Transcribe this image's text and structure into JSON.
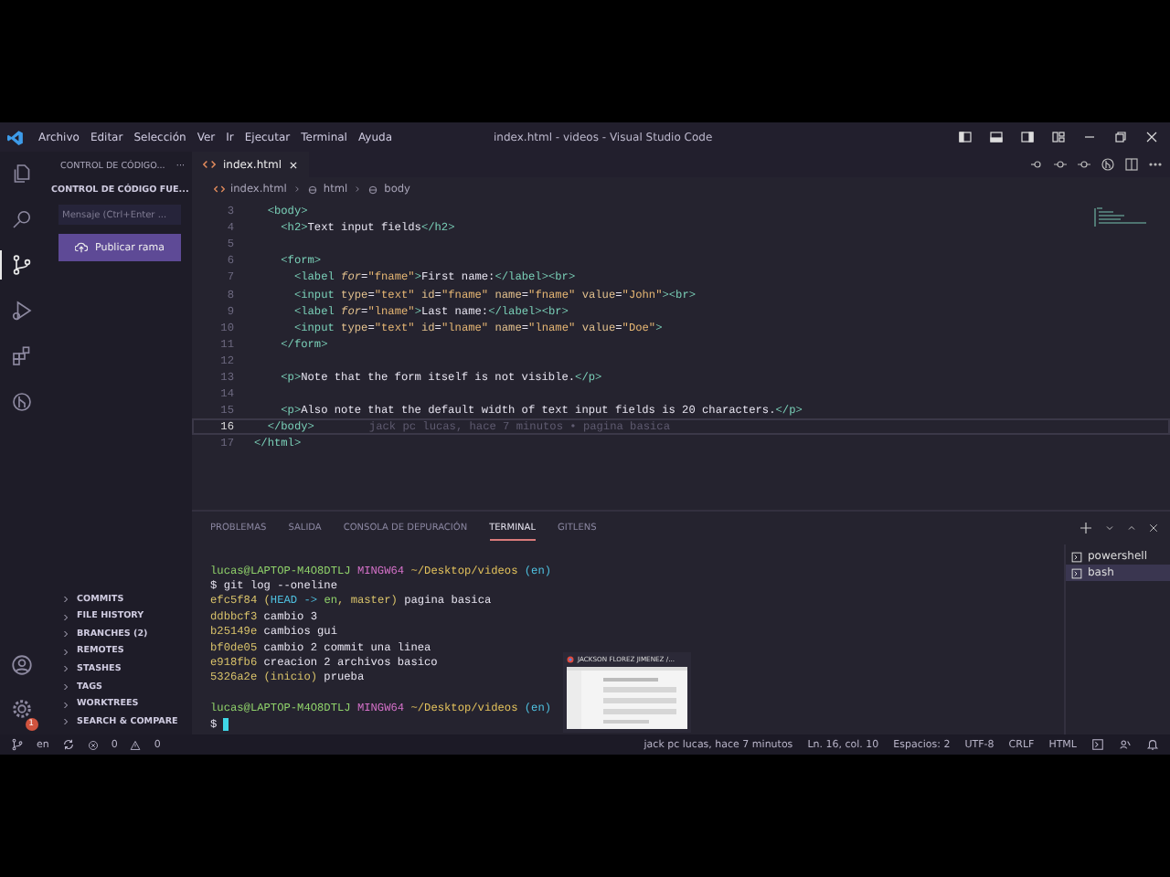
{
  "title_bar": {
    "menu": [
      "Archivo",
      "Editar",
      "Selección",
      "Ver",
      "Ir",
      "Ejecutar",
      "Terminal",
      "Ayuda"
    ],
    "title": "index.html - videos - Visual Studio Code"
  },
  "activity_bar": {
    "items": [
      {
        "kind": "files",
        "selected": false
      },
      {
        "kind": "search",
        "selected": false
      },
      {
        "kind": "source-control",
        "selected": true
      },
      {
        "kind": "run",
        "selected": false
      },
      {
        "kind": "extensions",
        "selected": false
      },
      {
        "kind": "gitlens",
        "selected": false
      }
    ],
    "settings_badge": "1"
  },
  "sidebar": {
    "header": "CONTROL DE CÓDIGO...",
    "more": "···",
    "section": "CONTROL DE CÓDIGO FUE...",
    "message": {
      "placeholder": "Mensaje (Ctrl+Enter ..."
    },
    "publish_button": "Publicar rama",
    "sections": [
      "COMMITS",
      "FILE HISTORY",
      "BRANCHES (2)",
      "REMOTES",
      "STASHES",
      "TAGS",
      "WORKTREES",
      "SEARCH & COMPARE"
    ]
  },
  "editor": {
    "tabs": [
      {
        "label": "index.html",
        "selected": true
      }
    ],
    "breadcrumbs": [
      "index.html",
      "html",
      "body"
    ],
    "blame": "jack pc lucas, hace 7 minutos • pagina basica",
    "lines": [
      {
        "number": "3",
        "current": false,
        "tokens": [
          {
            "kind": "tag",
            "text": "  <body>"
          }
        ]
      },
      {
        "number": "4",
        "current": false,
        "tokens": [
          {
            "kind": "tag",
            "text": "    <h2>"
          },
          {
            "kind": "text",
            "text": "Text input fields"
          },
          {
            "kind": "tag",
            "text": "</h2>"
          }
        ]
      },
      {
        "number": "5",
        "current": false
      },
      {
        "number": "6",
        "current": false,
        "tokens": [
          {
            "kind": "tag",
            "text": "    <form>"
          }
        ]
      },
      {
        "number": "7",
        "current": false,
        "tokens": [
          {
            "kind": "tag",
            "text": "      <label "
          },
          {
            "kind": "attr-italic",
            "text": "for"
          },
          {
            "kind": "text",
            "text": "="
          },
          {
            "kind": "string",
            "text": "\"fname\""
          },
          {
            "kind": "tag",
            "text": ">"
          },
          {
            "kind": "text",
            "text": "First name:"
          },
          {
            "kind": "tag",
            "text": "</label><br>"
          }
        ]
      },
      {
        "number": "8",
        "current": false,
        "tokens": [
          {
            "kind": "tag",
            "text": "      <input "
          },
          {
            "kind": "attr",
            "text": "type"
          },
          {
            "kind": "text",
            "text": "="
          },
          {
            "kind": "string",
            "text": "\"text\""
          },
          {
            "kind": "attr",
            "text": " id"
          },
          {
            "kind": "text",
            "text": "="
          },
          {
            "kind": "string",
            "text": "\"fname\""
          },
          {
            "kind": "attr",
            "text": " name"
          },
          {
            "kind": "text",
            "text": "="
          },
          {
            "kind": "string",
            "text": "\"fname\""
          },
          {
            "kind": "attr",
            "text": " value"
          },
          {
            "kind": "text",
            "text": "="
          },
          {
            "kind": "string",
            "text": "\"John\""
          },
          {
            "kind": "tag",
            "text": "><br>"
          }
        ]
      },
      {
        "number": "9",
        "current": false,
        "tokens": [
          {
            "kind": "tag",
            "text": "      <label "
          },
          {
            "kind": "attr-italic",
            "text": "for"
          },
          {
            "kind": "text",
            "text": "="
          },
          {
            "kind": "string",
            "text": "\"lname\""
          },
          {
            "kind": "tag",
            "text": ">"
          },
          {
            "kind": "text",
            "text": "Last name:"
          },
          {
            "kind": "tag",
            "text": "</label><br>"
          }
        ]
      },
      {
        "number": "10",
        "current": false,
        "tokens": [
          {
            "kind": "tag",
            "text": "      <input "
          },
          {
            "kind": "attr",
            "text": "type"
          },
          {
            "kind": "text",
            "text": "="
          },
          {
            "kind": "string",
            "text": "\"text\""
          },
          {
            "kind": "attr",
            "text": " id"
          },
          {
            "kind": "text",
            "text": "="
          },
          {
            "kind": "string",
            "text": "\"lname\""
          },
          {
            "kind": "attr",
            "text": " name"
          },
          {
            "kind": "text",
            "text": "="
          },
          {
            "kind": "string",
            "text": "\"lname\""
          },
          {
            "kind": "attr",
            "text": " value"
          },
          {
            "kind": "text",
            "text": "="
          },
          {
            "kind": "string",
            "text": "\"Doe\""
          },
          {
            "kind": "tag",
            "text": ">"
          }
        ]
      },
      {
        "number": "11",
        "current": false,
        "tokens": [
          {
            "kind": "tag",
            "text": "    </form>"
          }
        ]
      },
      {
        "number": "12",
        "current": false
      },
      {
        "number": "13",
        "current": false,
        "tokens": [
          {
            "kind": "tag",
            "text": "    <p>"
          },
          {
            "kind": "text",
            "text": "Note that the form itself is not visible."
          },
          {
            "kind": "tag",
            "text": "</p>"
          }
        ]
      },
      {
        "number": "14",
        "current": false
      },
      {
        "number": "15",
        "current": false,
        "tokens": [
          {
            "kind": "tag",
            "text": "    <p>"
          },
          {
            "kind": "text",
            "text": "Also note that the default width of text input fields is 20 characters."
          },
          {
            "kind": "tag",
            "text": "</p>"
          }
        ]
      },
      {
        "number": "16",
        "current": true,
        "tokens": [
          {
            "kind": "tag",
            "text": "  </body>"
          }
        ]
      },
      {
        "number": "17",
        "current": false,
        "tokens": [
          {
            "kind": "tag",
            "text": "</html>"
          }
        ]
      }
    ]
  },
  "panel": {
    "tabs": [
      {
        "label": "PROBLEMAS",
        "selected": false
      },
      {
        "label": "SALIDA",
        "selected": false
      },
      {
        "label": "CONSOLA DE DEPURACIÓN",
        "selected": false
      },
      {
        "label": "TERMINAL",
        "selected": true
      },
      {
        "label": "GITLENS",
        "selected": false
      }
    ],
    "terminal_blocks": [
      [
        [
          {
            "kind": "user",
            "text": "lucas@LAPTOP-M4O8DTLJ"
          },
          {
            "kind": "host",
            "text": " MINGW64"
          },
          {
            "kind": "path",
            "text": " ~/Desktop/videos"
          },
          {
            "kind": "branch",
            "text": " (en)"
          }
        ],
        [
          {
            "kind": "plain",
            "text": "$ git log --oneline"
          }
        ],
        [
          {
            "kind": "hash",
            "text": "efc5f84 ("
          },
          {
            "kind": "head",
            "text": "HEAD -> "
          },
          {
            "kind": "user",
            "text": "en"
          },
          {
            "kind": "hash",
            "text": ", master)"
          },
          {
            "kind": "plain",
            "text": " pagina basica"
          }
        ],
        [
          {
            "kind": "hash",
            "text": "ddbbcf3"
          },
          {
            "kind": "plain",
            "text": " cambio 3"
          }
        ],
        [
          {
            "kind": "hash",
            "text": "b25149e"
          },
          {
            "kind": "plain",
            "text": " cambios gui"
          }
        ],
        [
          {
            "kind": "hash",
            "text": "bf0de05"
          },
          {
            "kind": "plain",
            "text": " cambio 2 commit una linea"
          }
        ],
        [
          {
            "kind": "hash",
            "text": "e918fb6"
          },
          {
            "kind": "plain",
            "text": " creacion 2 archivos basico"
          }
        ],
        [
          {
            "kind": "hash",
            "text": "5326a2e (inicio)"
          },
          {
            "kind": "plain",
            "text": " prueba"
          }
        ]
      ],
      [
        [
          {
            "kind": "user",
            "text": "lucas@LAPTOP-M4O8DTLJ"
          },
          {
            "kind": "host",
            "text": " MINGW64"
          },
          {
            "kind": "path",
            "text": " ~/Desktop/videos"
          },
          {
            "kind": "branch",
            "text": " (en)"
          }
        ],
        [
          {
            "kind": "plain",
            "text": "$"
          }
        ]
      ]
    ],
    "sessions": [
      {
        "label": "powershell",
        "selected": false
      },
      {
        "label": "bash",
        "selected": true
      }
    ]
  },
  "preview_popup": {
    "title": "JACKSON FLOREZ JIMENEZ /..."
  },
  "status_bar": {
    "branch": "en",
    "errors": "0",
    "warnings": "0",
    "right": [
      "jack pc lucas, hace 7 minutos",
      "Ln. 16, col. 10",
      "Espacios: 2",
      "UTF-8",
      "CRLF",
      "HTML"
    ]
  }
}
